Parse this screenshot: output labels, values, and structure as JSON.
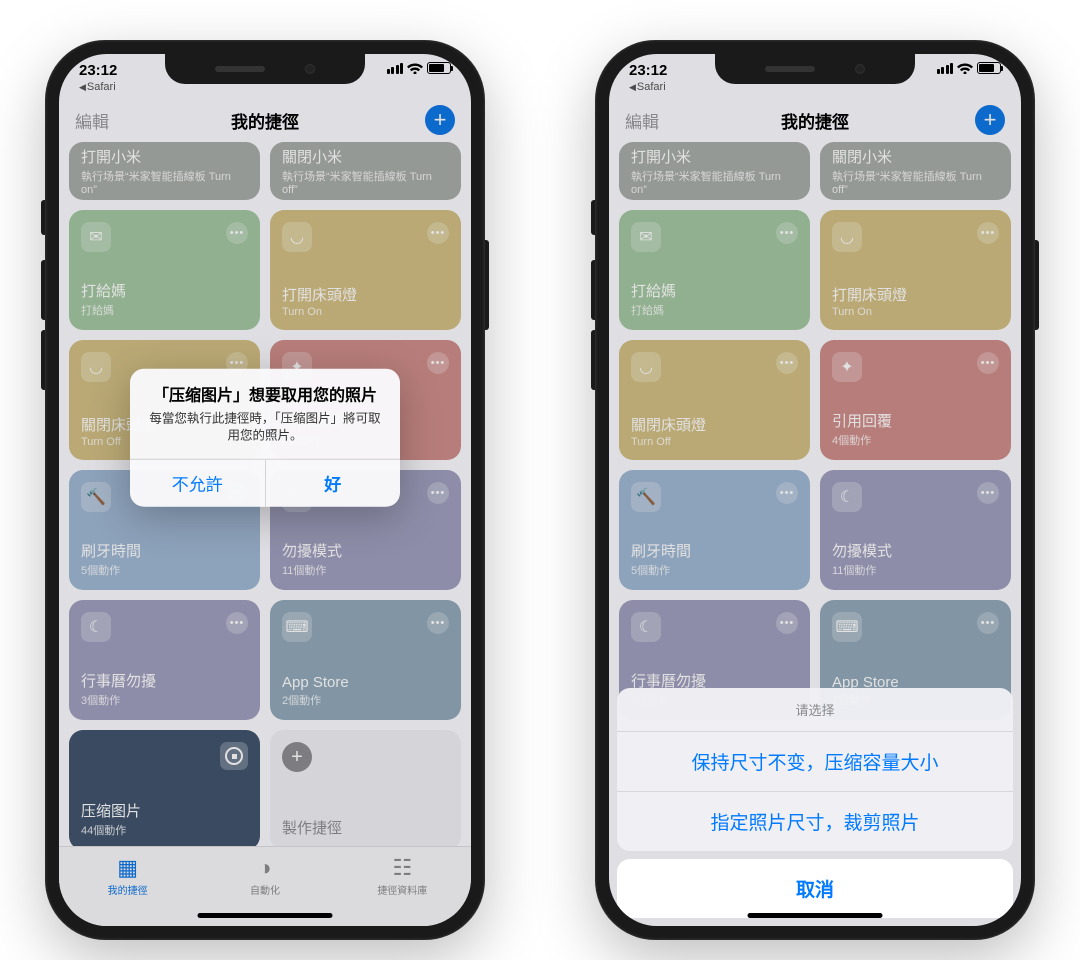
{
  "status": {
    "time": "23:12",
    "back_app": "Safari"
  },
  "nav": {
    "edit": "編輯",
    "title": "我的捷徑"
  },
  "tiles": {
    "t0": {
      "title": "打開小米",
      "sub": "執行场景“米家智能插線板 Turn on”"
    },
    "t1": {
      "title": "關閉小米",
      "sub": "執行场景“米家智能插線板 Turn off”"
    },
    "t2": {
      "title": "打給媽",
      "sub": "打給媽"
    },
    "t3": {
      "title": "打開床頭燈",
      "sub": "Turn On"
    },
    "t4": {
      "title": "關閉床頭燈",
      "sub": "Turn Off"
    },
    "t5": {
      "title": "引用回覆",
      "sub": "4個動作"
    },
    "t6": {
      "title": "刷牙時間",
      "sub": "5個動作"
    },
    "t7": {
      "title": "勿擾模式",
      "sub": "11個動作"
    },
    "t8": {
      "title": "行事曆勿擾",
      "sub": "3個動作"
    },
    "t9": {
      "title": "App Store",
      "sub": "2個動作"
    },
    "t10": {
      "title": "压缩图片",
      "sub": "44個動作"
    },
    "create": "製作捷徑"
  },
  "tabs": {
    "t1": "我的捷徑",
    "t2": "自動化",
    "t3": "捷徑資料庫"
  },
  "alert": {
    "title": "「压缩图片」想要取用您的照片",
    "message": "每當您執行此捷徑時，「压缩图片」將可取用您的照片。",
    "deny": "不允許",
    "allow": "好"
  },
  "sheet": {
    "title": "请选择",
    "opt1": "保持尺寸不变，压缩容量大小",
    "opt2": "指定照片尺寸，裁剪照片",
    "cancel": "取消"
  }
}
